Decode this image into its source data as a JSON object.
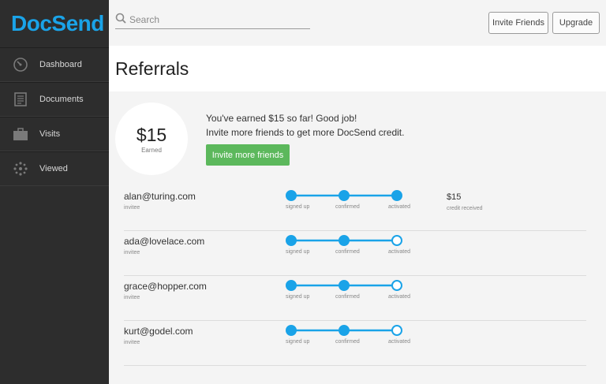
{
  "app": {
    "logo": "DocSend",
    "accent": "#1aa3e8"
  },
  "sidebar": {
    "items": [
      {
        "label": "Dashboard",
        "icon": "dashboard-gauge-icon"
      },
      {
        "label": "Documents",
        "icon": "documents-icon"
      },
      {
        "label": "Visits",
        "icon": "briefcase-icon"
      },
      {
        "label": "Viewed",
        "icon": "viewed-dots-icon"
      }
    ]
  },
  "topbar": {
    "search_placeholder": "Search",
    "invite_friends_label": "Invite Friends",
    "upgrade_label": "Upgrade"
  },
  "page": {
    "title": "Referrals"
  },
  "summary": {
    "amount": "$15",
    "amount_label": "Earned",
    "message_line1": "You've earned $15 so far! Good job!",
    "message_line2": "Invite more friends to get more DocSend credit.",
    "invite_more_label": "Invite more friends",
    "button_color": "#5cb85c"
  },
  "steps": [
    "signed up",
    "confirmed",
    "activated"
  ],
  "referrals": [
    {
      "email": "alan@turing.com",
      "role": "invitee",
      "completed": [
        true,
        true,
        true
      ],
      "credit": "$15",
      "credit_label": "credit received"
    },
    {
      "email": "ada@lovelace.com",
      "role": "invitee",
      "completed": [
        true,
        true,
        false
      ]
    },
    {
      "email": "grace@hopper.com",
      "role": "invitee",
      "completed": [
        true,
        true,
        false
      ]
    },
    {
      "email": "kurt@godel.com",
      "role": "invitee",
      "completed": [
        true,
        true,
        false
      ]
    }
  ]
}
